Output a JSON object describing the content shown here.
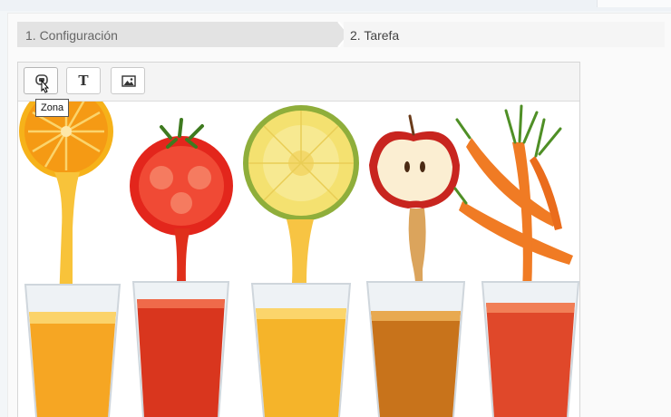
{
  "wizard": {
    "steps": [
      {
        "label": "1. Configuración",
        "active": true
      },
      {
        "label": "2. Tarefa",
        "active": false
      }
    ]
  },
  "toolbar": {
    "zone_tooltip": "Zona",
    "tools": [
      {
        "name": "zona",
        "icon": "zone-icon"
      },
      {
        "name": "text",
        "icon": "text-icon",
        "glyph": "T"
      },
      {
        "name": "image",
        "icon": "image-icon"
      }
    ]
  },
  "canvas_image": {
    "subject": "fruit juices poured into glasses",
    "items": [
      "orange",
      "tomato",
      "pineapple",
      "apple",
      "carrot"
    ]
  },
  "colors": {
    "step_active": "#e3e3e3",
    "step_inactive": "#f5f5f5",
    "toolbar_bg": "#f4f4f4",
    "orange_juice": "#f4a623",
    "tomato_juice": "#d93a1e",
    "apple_juice": "#c8731b"
  }
}
